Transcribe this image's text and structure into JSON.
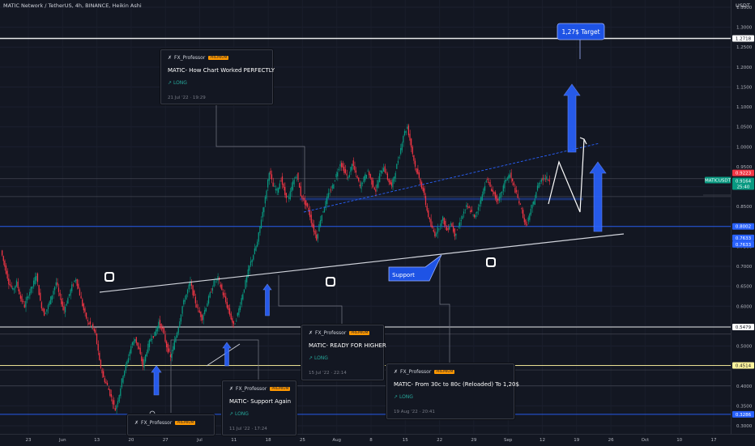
{
  "header": {
    "symbol_line": "MATIC Network / TetherUS, 4h, BINANCE, Heikin Ashi",
    "currency": "USDT"
  },
  "chart_data": {
    "type": "candlestick",
    "y_ticks": [
      "1.3500",
      "1.3000",
      "1.2500",
      "1.2000",
      "1.1500",
      "1.1000",
      "1.0500",
      "1.0000",
      "0.9500",
      "0.9000",
      "0.8500",
      "0.8000",
      "0.7500",
      "0.7000",
      "0.6500",
      "0.6000",
      "0.5500",
      "0.5000",
      "0.4500",
      "0.4000",
      "0.3500",
      "0.3000"
    ],
    "x_ticks": [
      "23",
      "Jun",
      "13",
      "20",
      "27",
      "Jul",
      "11",
      "18",
      "25",
      "Aug",
      "8",
      "15",
      "22",
      "29",
      "Sep",
      "12",
      "19",
      "26",
      "Oct",
      "10",
      "17"
    ],
    "price_labels": [
      {
        "text": "1.2718",
        "value": 1.2718,
        "color": "#ffffff"
      },
      {
        "text": "0.9223",
        "value": 0.9223,
        "color": "#f23645"
      },
      {
        "text": "MATICUSDT",
        "value": 0.9164,
        "color": "#089981"
      },
      {
        "text": "0.9164",
        "value": 0.9164,
        "color": "#089981"
      },
      {
        "text": "25:40",
        "value": 0.9164,
        "color": "#089981"
      },
      {
        "text": "0.8002",
        "value": 0.8002,
        "color": "#2962ff"
      },
      {
        "text": "0.7633",
        "value": 0.7633,
        "color": "#2962ff"
      },
      {
        "text": "0.7633",
        "value": 0.7633,
        "color": "#2962ff"
      },
      {
        "text": "0.5479",
        "value": 0.5479,
        "color": "#ffffff"
      },
      {
        "text": "0.4514",
        "value": 0.4514,
        "color": "#fff59d"
      },
      {
        "text": "0.3286",
        "value": 0.3286,
        "color": "#2962ff"
      }
    ],
    "horizontal_levels": [
      {
        "value": 1.2718,
        "color": "#ffffff"
      },
      {
        "value": 0.8002,
        "color": "#2962ff"
      },
      {
        "value": 0.5479,
        "color": "#ffffff"
      },
      {
        "value": 0.4514,
        "color": "#fff59d"
      },
      {
        "value": 0.3286,
        "color": "#2962ff"
      }
    ],
    "price_path": [
      0.74,
      0.7,
      0.66,
      0.64,
      0.66,
      0.62,
      0.6,
      0.63,
      0.65,
      0.68,
      0.61,
      0.58,
      0.6,
      0.63,
      0.66,
      0.62,
      0.59,
      0.62,
      0.65,
      0.67,
      0.63,
      0.59,
      0.56,
      0.55,
      0.53,
      0.46,
      0.42,
      0.4,
      0.37,
      0.34,
      0.38,
      0.43,
      0.46,
      0.5,
      0.52,
      0.49,
      0.45,
      0.49,
      0.52,
      0.53,
      0.56,
      0.54,
      0.5,
      0.47,
      0.51,
      0.55,
      0.6,
      0.63,
      0.66,
      0.62,
      0.59,
      0.57,
      0.6,
      0.63,
      0.66,
      0.67,
      0.64,
      0.61,
      0.58,
      0.55,
      0.58,
      0.62,
      0.66,
      0.7,
      0.73,
      0.76,
      0.82,
      0.87,
      0.94,
      0.9,
      0.89,
      0.92,
      0.88,
      0.87,
      0.91,
      0.93,
      0.88,
      0.86,
      0.84,
      0.8,
      0.77,
      0.82,
      0.85,
      0.88,
      0.9,
      0.93,
      0.96,
      0.94,
      0.92,
      0.96,
      0.93,
      0.9,
      0.92,
      0.94,
      0.91,
      0.89,
      0.93,
      0.95,
      0.92,
      0.9,
      0.94,
      0.98,
      1.03,
      1.05,
      1.0,
      0.95,
      0.92,
      0.89,
      0.84,
      0.8,
      0.78,
      0.8,
      0.82,
      0.79,
      0.81,
      0.78,
      0.8,
      0.83,
      0.85,
      0.84,
      0.82,
      0.85,
      0.88,
      0.92,
      0.9,
      0.88,
      0.86,
      0.89,
      0.92,
      0.93,
      0.9,
      0.87,
      0.84,
      0.8,
      0.83,
      0.86,
      0.9,
      0.92,
      0.9223,
      0.9164
    ],
    "annotations": [
      {
        "text": "1,27$ Target"
      },
      {
        "text": "Support"
      }
    ]
  },
  "ideas": [
    {
      "author": "FX_Professor",
      "badge": "PREMIUM",
      "title": "MATIC- How Chart Worked PERFECTLY",
      "direction": "LONG",
      "date": "21 Jul '22 · 19:29"
    },
    {
      "author": "FX_Professor",
      "badge": "PREMIUM",
      "title": "MATIC- READY FOR HIGHER",
      "direction": "LONG",
      "date": "15 Jul '22 · 22:14"
    },
    {
      "author": "FX_Professor",
      "badge": "PREMIUM",
      "title": "MATIC- From 30c to 80c (Reloaded) To 1,20$",
      "direction": "LONG",
      "date": "19 Aug '22 · 20:41"
    },
    {
      "author": "FX_Professor",
      "badge": "PREMIUM",
      "title": "MATIC- Support Again",
      "direction": "LONG",
      "date": "11 Jul '22 · 17:24"
    },
    {
      "author": "FX_Professor",
      "badge": "PREMIUM",
      "title": "",
      "direction": "",
      "date": ""
    }
  ],
  "colors": {
    "up": "#089981",
    "down": "#f23645",
    "accent": "#2962ff",
    "bg": "#131722"
  }
}
